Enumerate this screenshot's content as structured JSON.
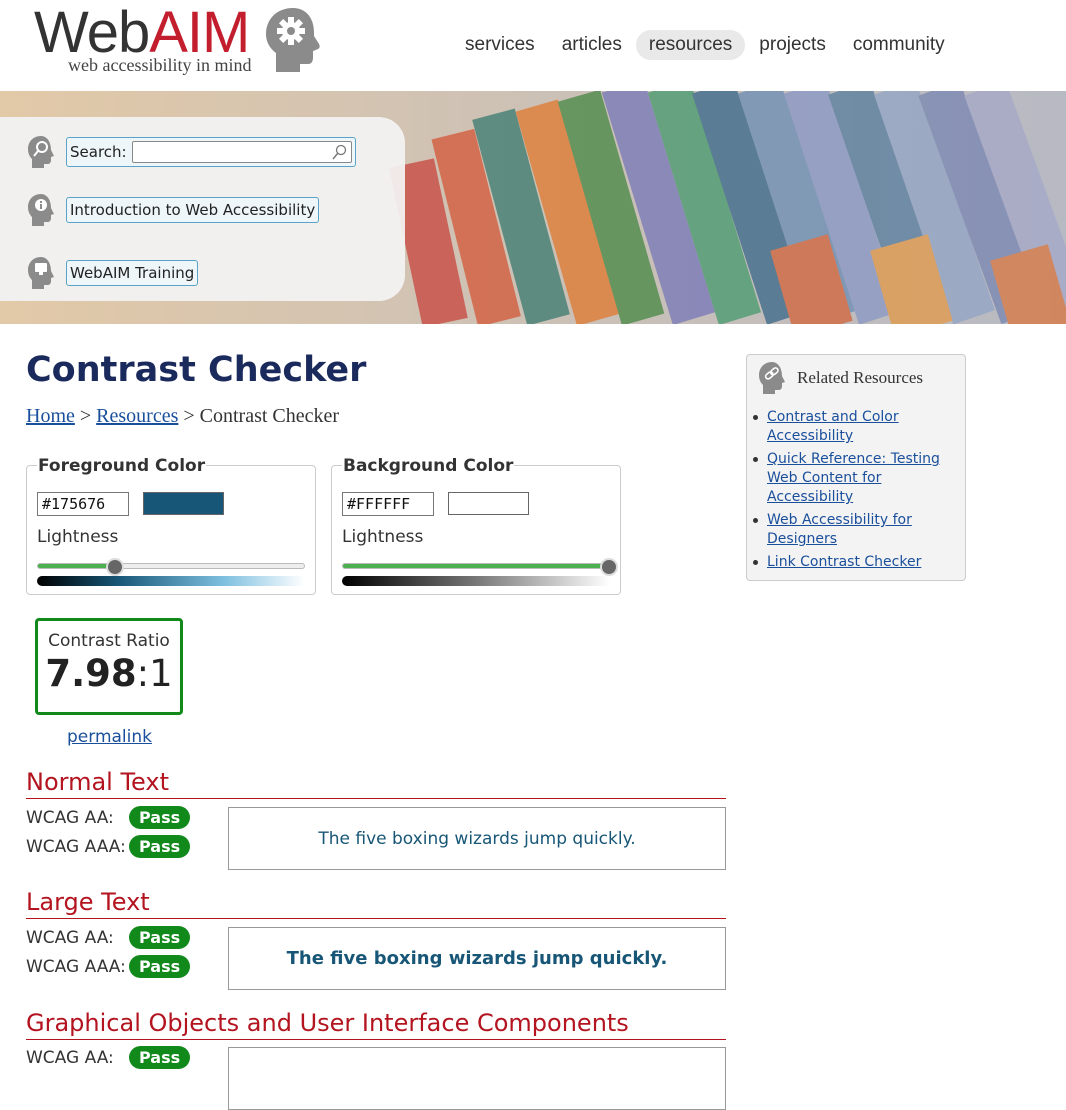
{
  "header": {
    "logo_part1": "Web",
    "logo_part2": "AIM",
    "logo_tagline": "web accessibility in mind",
    "nav": [
      "services",
      "articles",
      "resources",
      "projects",
      "community"
    ],
    "active_nav": "resources"
  },
  "quick_links": {
    "search_label": "Search:",
    "search_value": "",
    "intro_link": "Introduction to Web Accessibility",
    "training_link": "WebAIM Training"
  },
  "page": {
    "title": "Contrast Checker",
    "breadcrumb": {
      "home": "Home",
      "sep1": " > ",
      "resources": "Resources",
      "sep2": " > ",
      "current": "Contrast Checker"
    }
  },
  "foreground": {
    "legend": "Foreground Color",
    "hex": "#175676",
    "swatch_color": "#175676",
    "lightness_label": "Lightness",
    "lightness_fraction": 0.29
  },
  "background": {
    "legend": "Background Color",
    "hex": "#FFFFFF",
    "swatch_color": "#FFFFFF",
    "lightness_label": "Lightness",
    "lightness_fraction": 1.0
  },
  "contrast": {
    "label": "Contrast Ratio",
    "value": "7.98",
    "suffix": ":1",
    "permalink": "permalink"
  },
  "sections": {
    "normal": {
      "title": "Normal Text",
      "aa_label": "WCAG AA:",
      "aa_result": "Pass",
      "aaa_label": "WCAG AAA:",
      "aaa_result": "Pass",
      "sample": "The five boxing wizards jump quickly."
    },
    "large": {
      "title": "Large Text",
      "aa_label": "WCAG AA:",
      "aa_result": "Pass",
      "aaa_label": "WCAG AAA:",
      "aaa_result": "Pass",
      "sample": "The five boxing wizards jump quickly."
    },
    "graphical": {
      "title": "Graphical Objects and User Interface Components",
      "aa_label": "WCAG AA:",
      "aa_result": "Pass"
    }
  },
  "related": {
    "title": "Related Resources",
    "links": [
      "Contrast and Color Accessibility",
      "Quick Reference: Testing Web Content for Accessibility",
      "Web Accessibility for Designers",
      "Link Contrast Checker"
    ]
  },
  "colors": {
    "brand_red": "#c31e2d",
    "title_navy": "#1b2a5c",
    "section_red": "#b3141f",
    "pass_green": "#128a1b",
    "link_blue": "#1a4f9c"
  }
}
